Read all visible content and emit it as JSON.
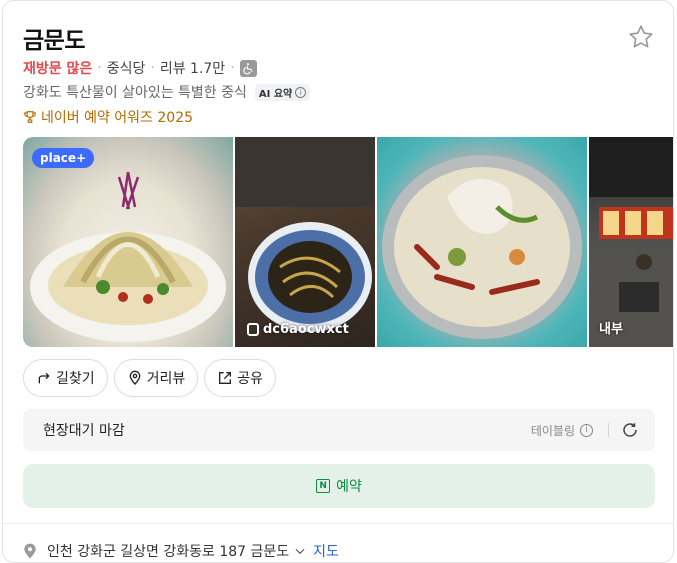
{
  "place": {
    "name": "금문도",
    "meta": {
      "highlight": "재방문 많은",
      "category": "중식당",
      "reviews": "리뷰 1.7만"
    },
    "description": "강화도 특산물이 살아있는 특별한 중식",
    "ai_badge": "AI 요약",
    "award": "네이버 예약 어워즈 2025"
  },
  "photos": {
    "badge": "place+",
    "user": "dc6aocwxct",
    "interior_label": "내부"
  },
  "actions": [
    {
      "label": "길찾기",
      "icon": "directions-icon"
    },
    {
      "label": "거리뷰",
      "icon": "location-pin-icon"
    },
    {
      "label": "공유",
      "icon": "share-icon"
    }
  ],
  "waiting": {
    "status": "현장대기 마감",
    "provider": "테이블링"
  },
  "reserve": {
    "label": "예약",
    "icon_letter": "N"
  },
  "address": {
    "text": "인천 강화군 길상면 강화동로 187 금문도",
    "map_link": "지도"
  },
  "colors": {
    "highlight": "#e5484d",
    "award": "#b36b00",
    "reserve_bg": "#e3f1e8",
    "reserve_text": "#0f8a47",
    "badge_blue": "#3d6bff",
    "link": "#2463d8"
  }
}
